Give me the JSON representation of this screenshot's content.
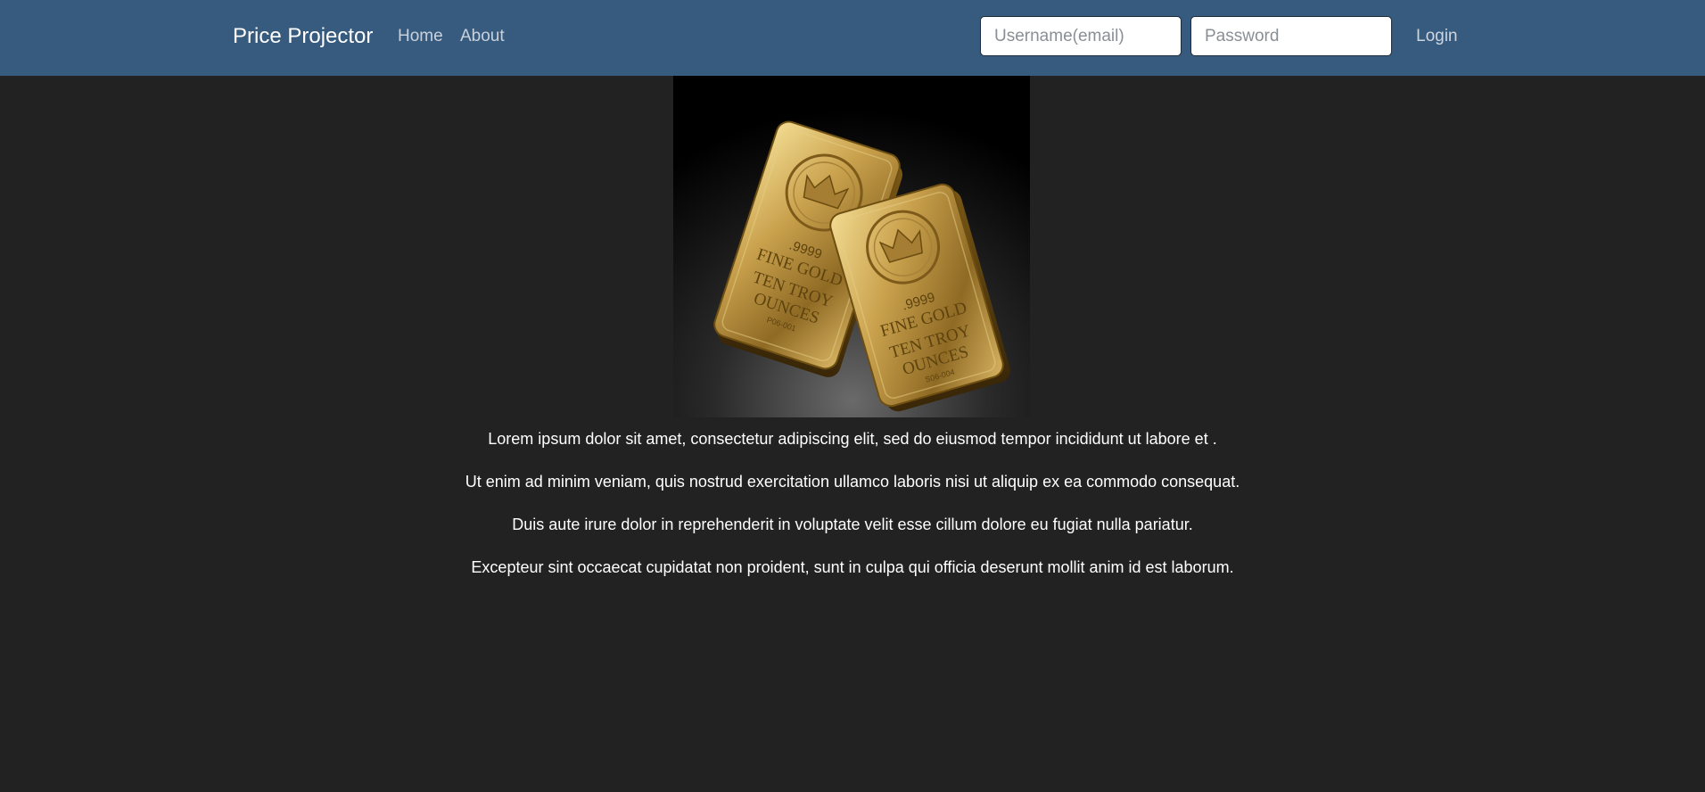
{
  "navbar": {
    "brand": "Price Projector",
    "links": [
      {
        "label": "Home"
      },
      {
        "label": "About"
      }
    ],
    "login_form": {
      "username_placeholder": "Username(email)",
      "password_placeholder": "Password",
      "login_label": "Login"
    },
    "background_color": "#375a7f"
  },
  "hero": {
    "bars": [
      {
        "purity": ".9999",
        "line1": "FINE GOLD",
        "line2": "TEN TROY",
        "line3": "OUNCES",
        "serial": "P06-001"
      },
      {
        "purity": ".9999",
        "line1": "FINE GOLD",
        "line2": "TEN TROY",
        "line3": "OUNCES",
        "serial": "S06-004"
      }
    ]
  },
  "content": {
    "lines": [
      "Lorem ipsum dolor sit amet, consectetur adipiscing elit, sed do eiusmod tempor incididunt ut labore et .",
      "Ut enim ad minim veniam, quis nostrud exercitation ullamco laboris nisi ut aliquip ex ea commodo consequat.",
      "Duis aute irure dolor in reprehenderit in voluptate velit esse cillum dolore eu fugiat nulla pariatur.",
      "Excepteur sint occaecat cupidatat non proident, sunt in culpa qui officia deserunt mollit anim id est laborum."
    ]
  },
  "colors": {
    "page_background": "#222222",
    "text": "#ffffff",
    "gold": "#c9a24a"
  }
}
